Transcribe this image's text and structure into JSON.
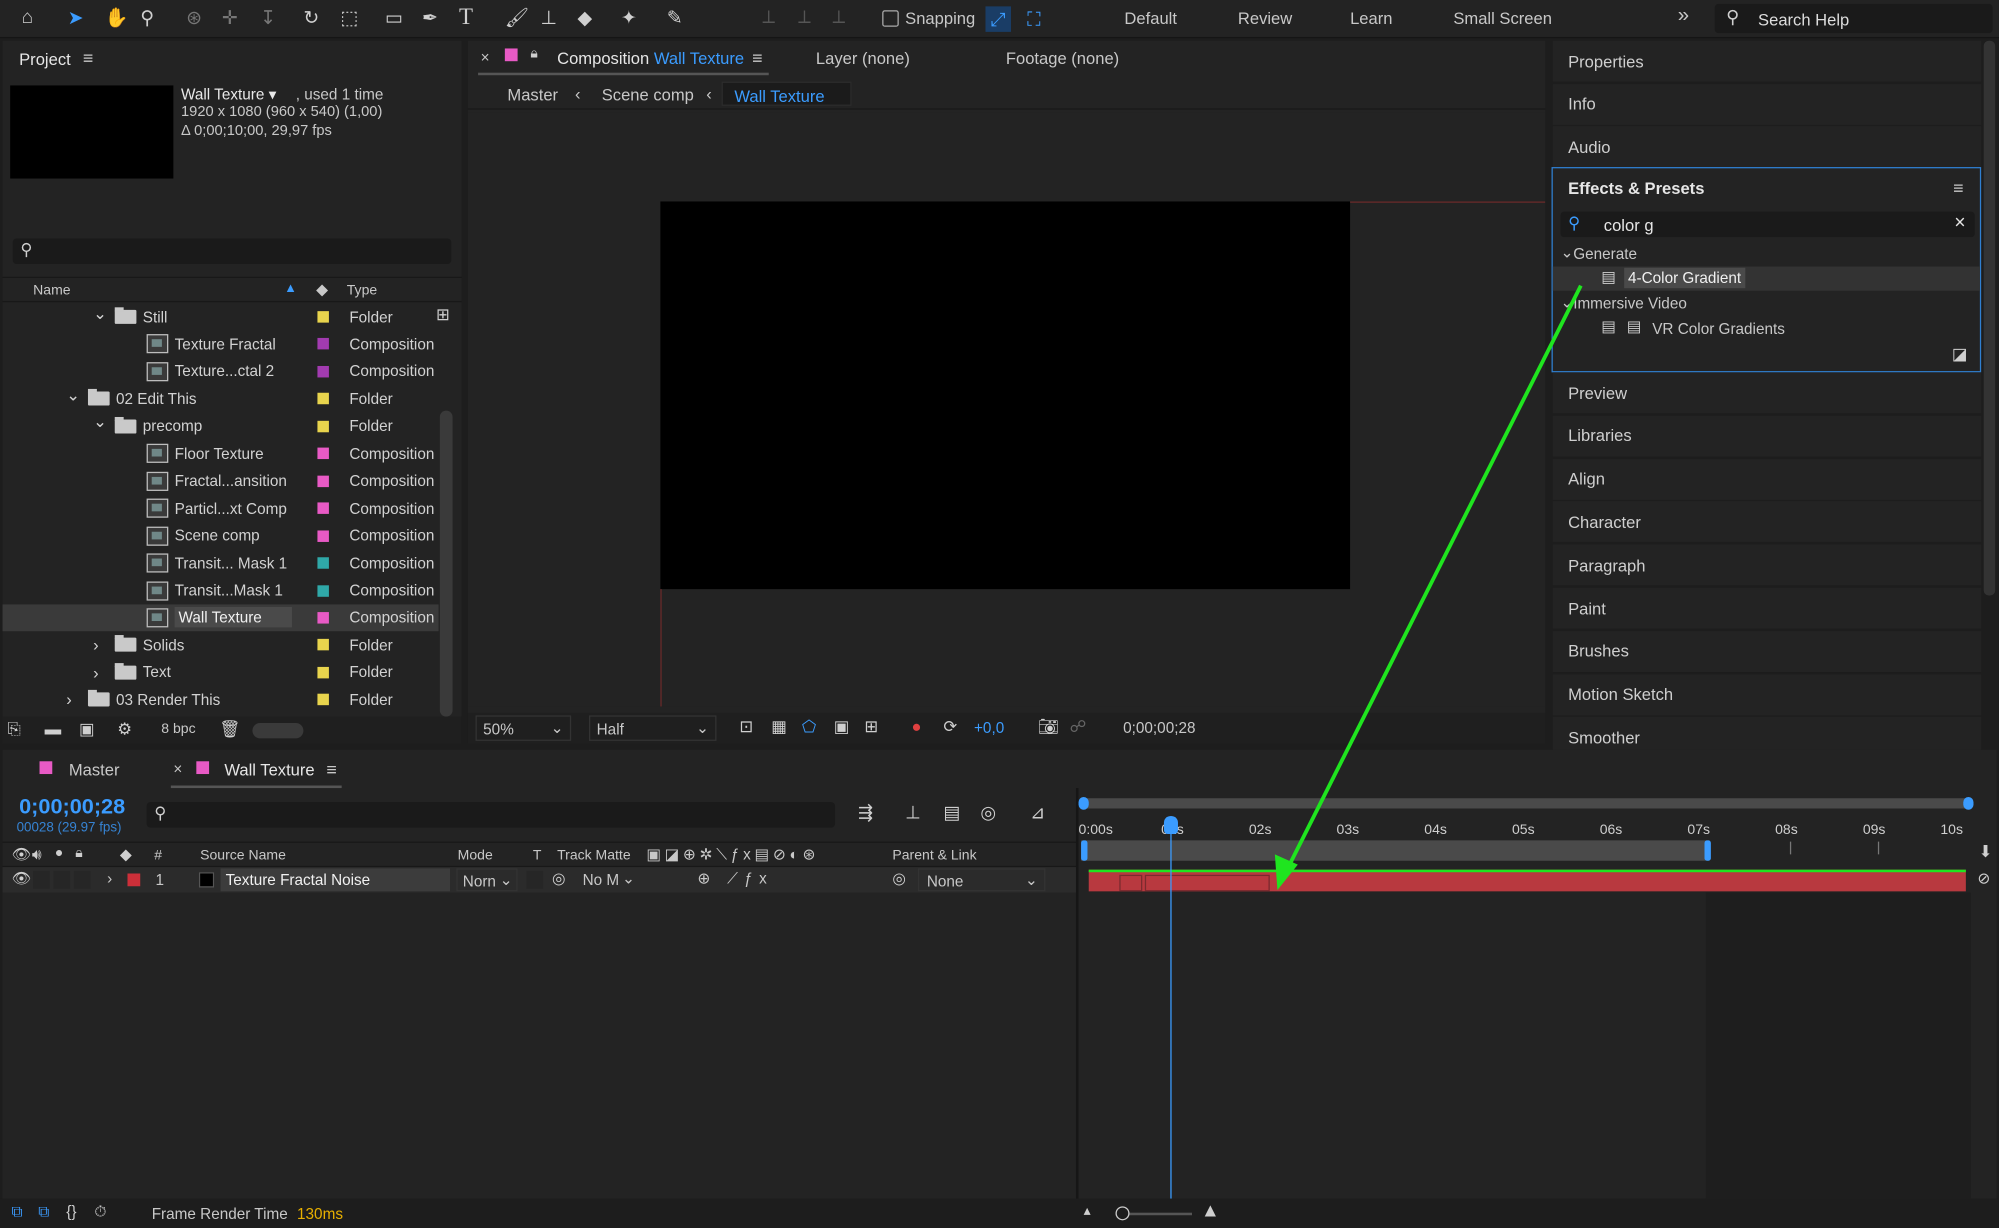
{
  "toolbar": {
    "snapping": "Snapping",
    "workspaces": [
      "Default",
      "Review",
      "Learn",
      "Small Screen"
    ],
    "overflow": "»",
    "search_help": "Search Help"
  },
  "project": {
    "title": "Project",
    "preview_name": "Wall Texture ▾",
    "used": ", used 1 time",
    "line2": "1920 x 1080  (960 x 540) (1,00)",
    "line3": "Δ 0;00;10;00, 29,97 fps",
    "col_name": "Name",
    "col_type": "Type",
    "bpc": "8 bpc",
    "items": [
      {
        "name": "Still",
        "type": "Folder",
        "kind": "folder",
        "expanded": true,
        "indent": 1,
        "color": "#e8d44d"
      },
      {
        "name": "Texture Fractal",
        "type": "Composition",
        "kind": "comp",
        "indent": 2,
        "color": "#a23bb0"
      },
      {
        "name": "Texture...ctal 2",
        "type": "Composition",
        "kind": "comp",
        "indent": 2,
        "color": "#a23bb0"
      },
      {
        "name": "02 Edit This",
        "type": "Folder",
        "kind": "folder",
        "expanded": true,
        "indent": 0,
        "color": "#e8d44d"
      },
      {
        "name": "precomp",
        "type": "Folder",
        "kind": "folder",
        "expanded": true,
        "indent": 1,
        "color": "#e8d44d"
      },
      {
        "name": "Floor Texture",
        "type": "Composition",
        "kind": "comp",
        "indent": 2,
        "color": "#e85ac5"
      },
      {
        "name": "Fractal...ansition",
        "type": "Composition",
        "kind": "comp",
        "indent": 2,
        "color": "#e85ac5"
      },
      {
        "name": "Particl...xt Comp",
        "type": "Composition",
        "kind": "comp",
        "indent": 2,
        "color": "#e85ac5"
      },
      {
        "name": "Scene comp",
        "type": "Composition",
        "kind": "comp",
        "indent": 2,
        "color": "#e85ac5"
      },
      {
        "name": "Transit... Mask 1",
        "type": "Composition",
        "kind": "comp",
        "indent": 2,
        "color": "#2fa8a8"
      },
      {
        "name": "Transit...Mask 1",
        "type": "Composition",
        "kind": "comp",
        "indent": 2,
        "color": "#2fa8a8"
      },
      {
        "name": "Wall Texture",
        "type": "Composition",
        "kind": "comp",
        "indent": 2,
        "color": "#e85ac5",
        "selected": true
      },
      {
        "name": "Solids",
        "type": "Folder",
        "kind": "folder",
        "expanded": false,
        "indent": 1,
        "color": "#e8d44d"
      },
      {
        "name": "Text",
        "type": "Folder",
        "kind": "folder",
        "expanded": false,
        "indent": 1,
        "color": "#e8d44d"
      },
      {
        "name": "03 Render This",
        "type": "Folder",
        "kind": "folder",
        "expanded": false,
        "indent": 0,
        "color": "#e8d44d"
      }
    ]
  },
  "viewer": {
    "comp_tab_prefix": "Composition",
    "comp_tab_name": "Wall Texture",
    "layer_tab": "Layer (none)",
    "footage_tab": "Footage (none)",
    "crumbs": [
      "Master",
      "Scene comp",
      "Wall Texture"
    ],
    "zoom": "50%",
    "resolution": "Half",
    "exposure": "+0,0",
    "timecode": "0;00;00;28"
  },
  "right": {
    "top_panels": [
      "Properties",
      "Info",
      "Audio"
    ],
    "effects_title": "Effects & Presets",
    "search_value": "color g",
    "groups": [
      {
        "name": "Generate",
        "items": [
          "4-Color Gradient"
        ]
      },
      {
        "name": "Immersive Video",
        "items": [
          "VR Color Gradients"
        ]
      }
    ],
    "bottom_panels": [
      "Preview",
      "Libraries",
      "Align",
      "Character",
      "Paragraph",
      "Paint",
      "Brushes",
      "Motion Sketch",
      "Smoother"
    ]
  },
  "timeline": {
    "tabs": [
      "Master",
      "Wall Texture"
    ],
    "timecode": "0;00;00;28",
    "frames": "00028 (29.97 fps)",
    "col_num": "#",
    "col_source": "Source Name",
    "col_mode": "Mode",
    "col_t": "T",
    "col_track": "Track Matte",
    "col_parent": "Parent & Link",
    "layer": {
      "index": "1",
      "name": "Texture Fractal Noise",
      "mode": "Norn",
      "track": "No M",
      "parent": "None"
    },
    "ticks": [
      "0:00s",
      "01s",
      "02s",
      "03s",
      "04s",
      "05s",
      "06s",
      "07s",
      "08s",
      "09s",
      "10s"
    ]
  },
  "status": {
    "label": "Frame Render Time",
    "value": "130ms"
  },
  "colors": {
    "accent": "#3b9cff",
    "layer_bar": "#b8393f",
    "arrow": "#1fe51f"
  }
}
